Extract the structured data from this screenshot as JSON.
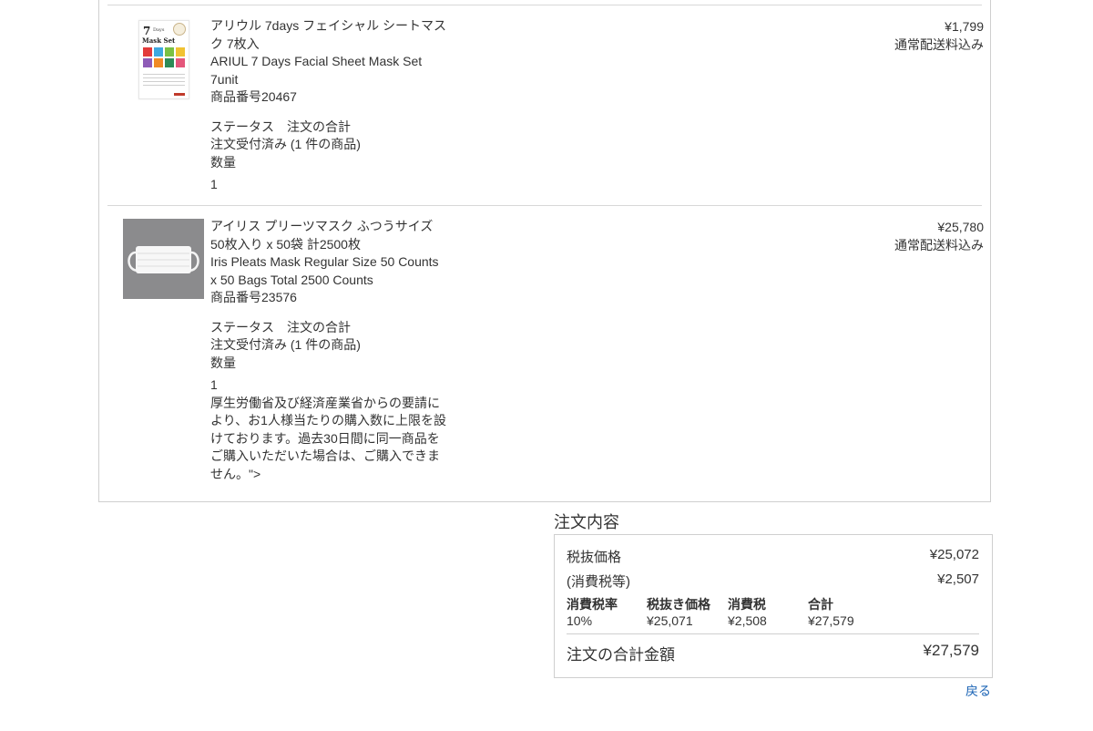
{
  "items": [
    {
      "name_ja": "アリウル 7days フェイシャル シートマスク 7枚入",
      "name_en": "ARIUL 7 Days Facial Sheet Mask Set 7unit",
      "product_no": "商品番号20467",
      "status_header": "ステータス　注文の合計",
      "status": "注文受付済み (1 件の商品)",
      "quantity_label": "数量",
      "quantity": "1",
      "price": "¥1,799",
      "shipping": "通常配送料込み",
      "thumb": {
        "title_num": "7",
        "title_small": "Days",
        "title_text": "Mask Set",
        "swatch_colors": [
          "#e23b3b",
          "#3da9e0",
          "#7ac143",
          "#f1c232",
          "#8e5bb7",
          "#f08a24",
          "#2e8b57",
          "#e4567b"
        ]
      }
    },
    {
      "name_ja": "アイリス プリーツマスク ふつうサイズ 50枚入り x 50袋 計2500枚",
      "name_en": "Iris Pleats Mask Regular Size 50 Counts x 50 Bags Total 2500 Counts",
      "product_no": "商品番号23576",
      "status_header": "ステータス　注文の合計",
      "status": "注文受付済み (1 件の商品)",
      "quantity_label": "数量",
      "quantity": "1",
      "note": "厚生労働省及び経済産業省からの要請により、お1人様当たりの購入数に上限を設けております。過去30日間に同一商品をご購入いただいた場合は、ご購入できません。\">",
      "price": "¥25,780",
      "shipping": "通常配送料込み"
    }
  ],
  "summary": {
    "title": "注文内容",
    "subtotal_label": "税抜価格",
    "subtotal": "¥25,072",
    "tax_label": "(消費税等)",
    "tax": "¥2,507",
    "tax_table": {
      "headers": [
        "消費税率",
        "税抜き価格",
        "消費税",
        "合計"
      ],
      "row": [
        "10%",
        "¥25,071",
        "¥2,508",
        "¥27,579"
      ]
    },
    "total_label": "注文の合計金額",
    "total": "¥27,579"
  },
  "back_link": "戻る",
  "colors": {
    "link": "#1a63b5",
    "border": "#cfcfcf",
    "text": "#333333"
  }
}
